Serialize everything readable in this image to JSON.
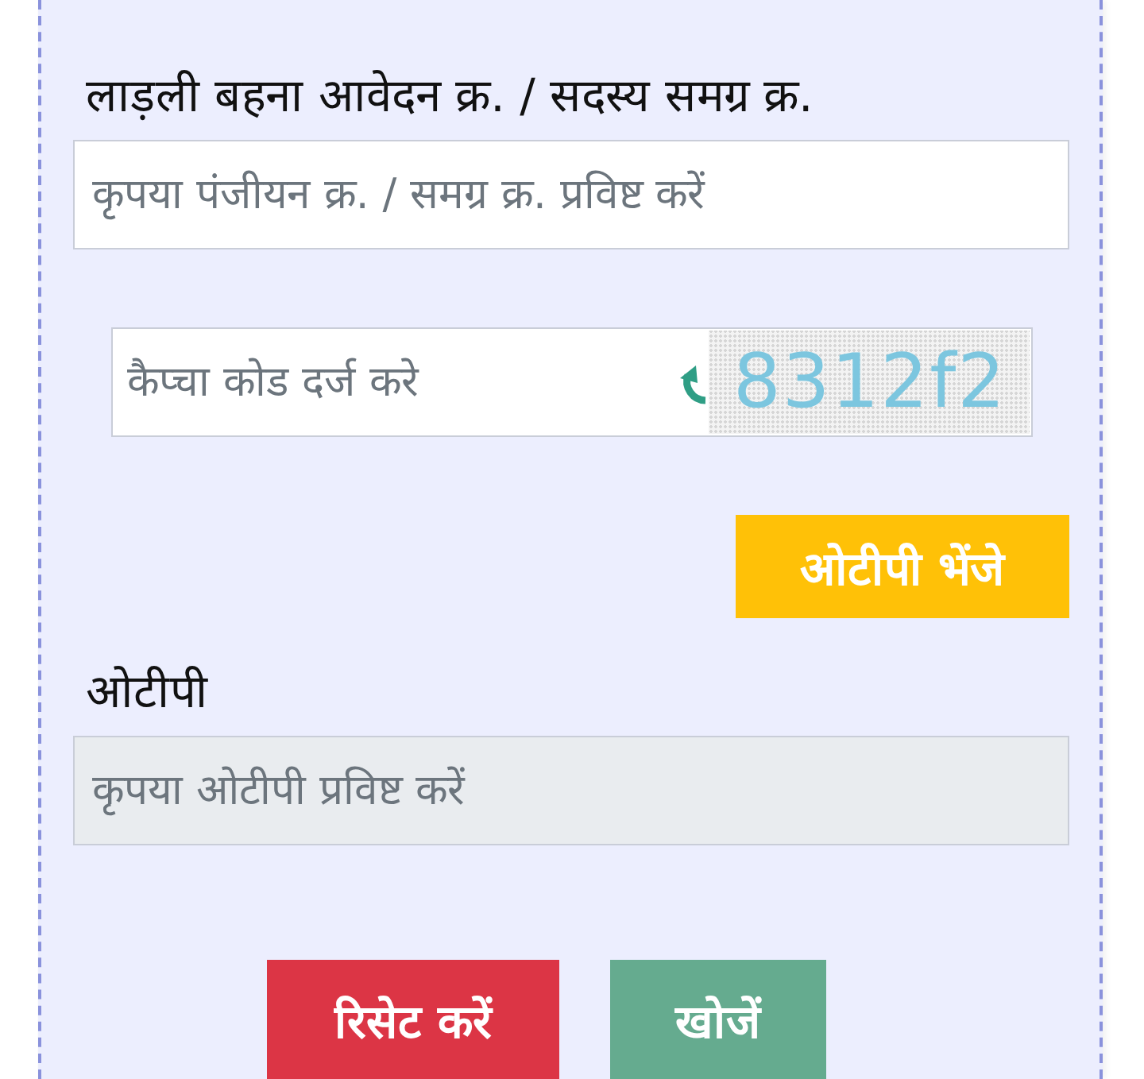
{
  "application_number": {
    "label": "लाड़ली बहना आवेदन क्र. / सदस्य समग्र क्र.",
    "placeholder": "कृपया पंजीयन क्र. / समग्र क्र. प्रविष्ट करें",
    "disabled": false
  },
  "captcha": {
    "placeholder": "कैप्चा कोड दर्ज करे",
    "code": "8312f2"
  },
  "send_otp_button": {
    "label": "ओटीपी भेंजे"
  },
  "otp": {
    "label": "ओटीपी",
    "placeholder": "कृपया ओटीपी प्रविष्ट करें",
    "disabled": true
  },
  "buttons": [
    {
      "kind": "reset",
      "label": "रिसेट करें"
    },
    {
      "kind": "search",
      "label": "खोजें"
    }
  ]
}
